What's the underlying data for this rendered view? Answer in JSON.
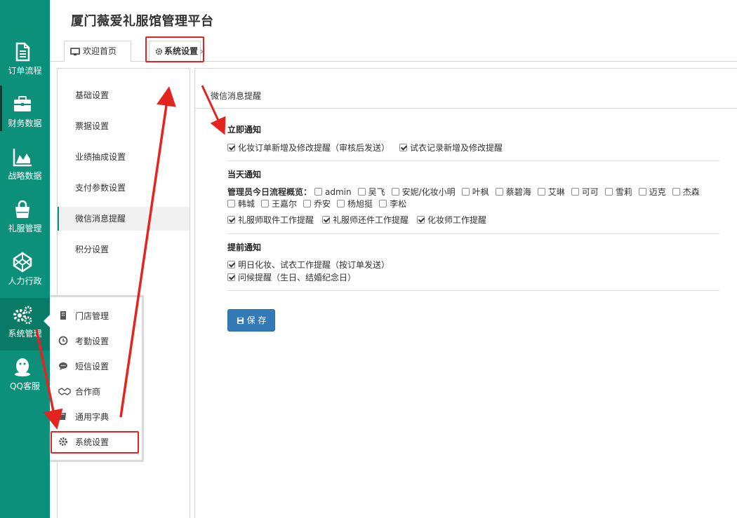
{
  "app_title": "厦门薇爱礼服馆管理平台",
  "nav": {
    "items": [
      {
        "label": "订单流程",
        "icon": "document-icon"
      },
      {
        "label": "财务数据",
        "icon": "briefcase-icon"
      },
      {
        "label": "战略数据",
        "icon": "area-chart-icon"
      },
      {
        "label": "礼服管理",
        "icon": "shopping-bag-icon"
      },
      {
        "label": "人力行政",
        "icon": "codepen-icon"
      },
      {
        "label": "系统管理",
        "icon": "gears-icon"
      },
      {
        "label": "QQ客服",
        "icon": "qq-icon"
      }
    ]
  },
  "tabs": {
    "welcome": "欢迎首页",
    "settings": "系统设置",
    "close": "×"
  },
  "settings_menu": {
    "items": [
      "基础设置",
      "票据设置",
      "业绩抽成设置",
      "支付参数设置",
      "微信消息提醒",
      "积分设置"
    ],
    "active": "微信消息提醒"
  },
  "content": {
    "title": "微信消息提醒",
    "immediate": {
      "title": "立即通知",
      "options": [
        {
          "label": "化妆订单新增及修改提醒（审核后发送）",
          "checked": true
        },
        {
          "label": "试衣记录新增及修改提醒",
          "checked": true
        }
      ]
    },
    "same_day": {
      "title": "当天通知",
      "admin_label": "管理员今日流程概览：",
      "admins": [
        "admin",
        "吴飞",
        "安妮/化妆小明",
        "叶枫",
        "蔡碧海",
        "艾琳",
        "可可",
        "雪莉",
        "迈克",
        "杰森",
        "韩城",
        "王嘉尔",
        "乔安",
        "杨旭挺",
        "李松"
      ],
      "options": [
        {
          "label": "礼服师取件工作提醒",
          "checked": true
        },
        {
          "label": "礼服师还件工作提醒",
          "checked": true
        },
        {
          "label": "化妆师工作提醒",
          "checked": true
        }
      ]
    },
    "advance": {
      "title": "提前通知",
      "options": [
        {
          "label": "明日化妆、试衣工作提醒（按订单发送）",
          "checked": true
        },
        {
          "label": "问候提醒（生日、结婚纪念日）",
          "checked": true
        }
      ]
    },
    "save_label": "保 存"
  },
  "popup": {
    "items": [
      {
        "label": "门店管理",
        "icon": "building-icon"
      },
      {
        "label": "考勤设置",
        "icon": "clock-icon"
      },
      {
        "label": "短信设置",
        "icon": "chat-bubble-icon"
      },
      {
        "label": "合作商",
        "icon": "handshake-icon"
      },
      {
        "label": "通用字典",
        "icon": "book-icon"
      },
      {
        "label": "系统设置",
        "icon": "gear-icon"
      }
    ]
  },
  "colors": {
    "nav_bg": "#0c9079",
    "primary_button": "#337ab7",
    "annotation_red": "#e5231f"
  }
}
